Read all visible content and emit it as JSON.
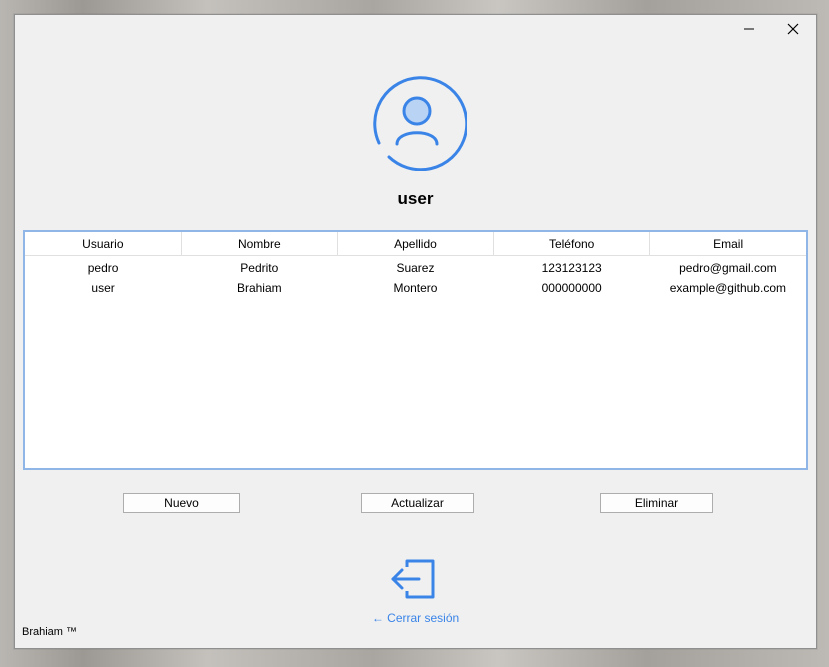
{
  "window": {
    "minimize_icon": "minimize-icon",
    "close_icon": "close-icon"
  },
  "profile": {
    "avatar_icon": "user-avatar-icon",
    "username": "user"
  },
  "table": {
    "columns": [
      "Usuario",
      "Nombre",
      "Apellido",
      "Teléfono",
      "Email"
    ],
    "rows": [
      [
        "pedro",
        "Pedrito",
        "Suarez",
        "123123123",
        "pedro@gmail.com"
      ],
      [
        "user",
        "Brahiam",
        "Montero",
        "000000000",
        "example@github.com"
      ]
    ]
  },
  "actions": {
    "nuevo": "Nuevo",
    "actualizar": "Actualizar",
    "eliminar": "Eliminar"
  },
  "logout": {
    "icon": "logout-icon",
    "label": "← Cerrar sesión"
  },
  "footer": {
    "text": "Brahiam ™"
  },
  "colors": {
    "accent": "#3a84e8",
    "table_border": "#8fb6e6",
    "window_bg": "#f0f0f0"
  }
}
